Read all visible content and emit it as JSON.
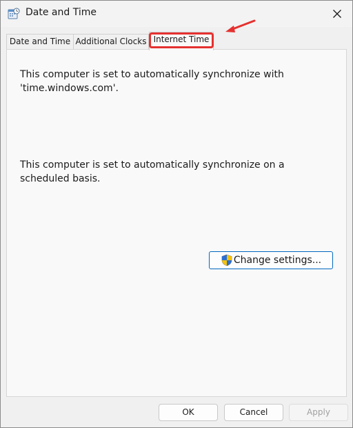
{
  "window": {
    "title": "Date and Time",
    "app_icon": "calendar-clock-icon",
    "close_icon": "close-icon"
  },
  "tabs": [
    {
      "label": "Date and Time",
      "active": false
    },
    {
      "label": "Additional Clocks",
      "active": false
    },
    {
      "label": "Internet Time",
      "active": true
    }
  ],
  "annotation": {
    "highlight_color": "#e5312f",
    "arrow_icon": "red-arrow-icon"
  },
  "content": {
    "sync_server_text": "This computer is set to automatically synchronize with 'time.windows.com'.",
    "schedule_text": "This computer is set to automatically synchronize on a scheduled basis.",
    "change_button_label": "Change settings...",
    "change_button_icon": "uac-shield-icon"
  },
  "footer": {
    "ok_label": "OK",
    "cancel_label": "Cancel",
    "apply_label": "Apply",
    "apply_enabled": false
  },
  "colors": {
    "accent": "#0067c0",
    "window_bg": "#f0f0f0",
    "panel_bg": "#f9f9f9"
  }
}
